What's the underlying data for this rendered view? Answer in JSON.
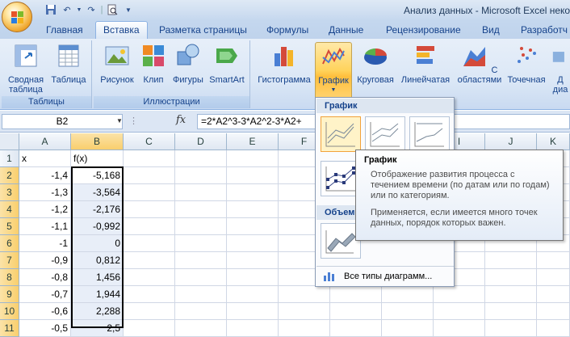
{
  "app": {
    "title": "Анализ данных - Microsoft Excel неко"
  },
  "tabs": [
    "Главная",
    "Вставка",
    "Разметка страницы",
    "Формулы",
    "Данные",
    "Рецензирование",
    "Вид",
    "Разработч"
  ],
  "ribbon": {
    "groups": {
      "tables": "Таблицы",
      "illustrations": "Иллюстрации"
    },
    "buttons": {
      "pivot": "Сводная таблица",
      "table": "Таблица",
      "picture": "Рисунок",
      "clip": "Клип",
      "shapes": "Фигуры",
      "smartart": "SmartArt",
      "histogram": "Гистограмма",
      "line": "График",
      "pie": "Круговая",
      "bar": "Линейчатая",
      "area": "С областями",
      "scatter": "Точечная",
      "other": "Д диа"
    }
  },
  "formula_bar": {
    "namebox": "B2",
    "fx": "fx",
    "formula": "=2*A2^3-3*A2^2-3*A2+"
  },
  "columns": [
    "A",
    "B",
    "C",
    "D",
    "E",
    "F",
    "G",
    "H",
    "I",
    "J",
    "K"
  ],
  "rows": [
    {
      "num": "1",
      "a": "x",
      "b": "f(x)"
    },
    {
      "num": "2",
      "a": "-1,4",
      "b": "-5,168"
    },
    {
      "num": "3",
      "a": "-1,3",
      "b": "-3,564"
    },
    {
      "num": "4",
      "a": "-1,2",
      "b": "-2,176"
    },
    {
      "num": "5",
      "a": "-1,1",
      "b": "-0,992"
    },
    {
      "num": "6",
      "a": "-1",
      "b": "0"
    },
    {
      "num": "7",
      "a": "-0,9",
      "b": "0,812"
    },
    {
      "num": "8",
      "a": "-0,8",
      "b": "1,456"
    },
    {
      "num": "9",
      "a": "-0,7",
      "b": "1,944"
    },
    {
      "num": "10",
      "a": "-0,6",
      "b": "2,288"
    },
    {
      "num": "11",
      "a": "-0,5",
      "b": "2,5"
    }
  ],
  "dropdown": {
    "header_2d": "График",
    "header_3d": "Объем",
    "all_charts": "Все типы диаграмм..."
  },
  "tooltip": {
    "title": "График",
    "line1": "Отображение развития процесса с течением времени (по датам или по годам) или по категориям.",
    "line2": "Применяется, если имеется много точек данных, порядок которых важен."
  }
}
